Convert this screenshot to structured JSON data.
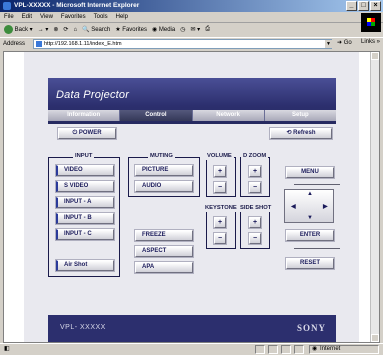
{
  "window": {
    "title": "VPL-XXXXX - Microsoft Internet Explorer"
  },
  "menu": [
    "File",
    "Edit",
    "View",
    "Favorites",
    "Tools",
    "Help"
  ],
  "toolbar": {
    "back": "Back",
    "search": "Search",
    "favorites": "Favorites",
    "media": "Media"
  },
  "address": {
    "label": "Address",
    "url": "http://192.168.1.11/index_E.htm",
    "go": "Go",
    "links": "Links"
  },
  "header": {
    "title": "Data Projector"
  },
  "tabs": [
    {
      "label": "Information"
    },
    {
      "label": "Control",
      "active": true
    },
    {
      "label": "Network"
    },
    {
      "label": "Setup"
    }
  ],
  "controls": {
    "power": "POWER",
    "refresh": "Refresh",
    "input": {
      "label": "INPUT",
      "items": [
        "VIDEO",
        "S VIDEO",
        "INPUT - A",
        "INPUT - B",
        "INPUT - C"
      ],
      "air_shot": "Air Shot"
    },
    "muting": {
      "label": "MUTING",
      "items": [
        "PICTURE",
        "AUDIO"
      ]
    },
    "volume": {
      "label": "VOLUME"
    },
    "d_zoom": {
      "label": "D ZOOM"
    },
    "keystone": {
      "label": "KEYSTONE"
    },
    "side_shot": {
      "label": "SIDE SHOT"
    },
    "freeze": "FREEZE",
    "aspect": "ASPECT",
    "apa": "APA",
    "menu": "MENU",
    "enter": "ENTER",
    "reset": "RESET",
    "plus": "+",
    "minus": "−"
  },
  "footer": {
    "model": "VPL- XXXXX",
    "brand": "SONY"
  },
  "status": {
    "zone": "Internet"
  }
}
